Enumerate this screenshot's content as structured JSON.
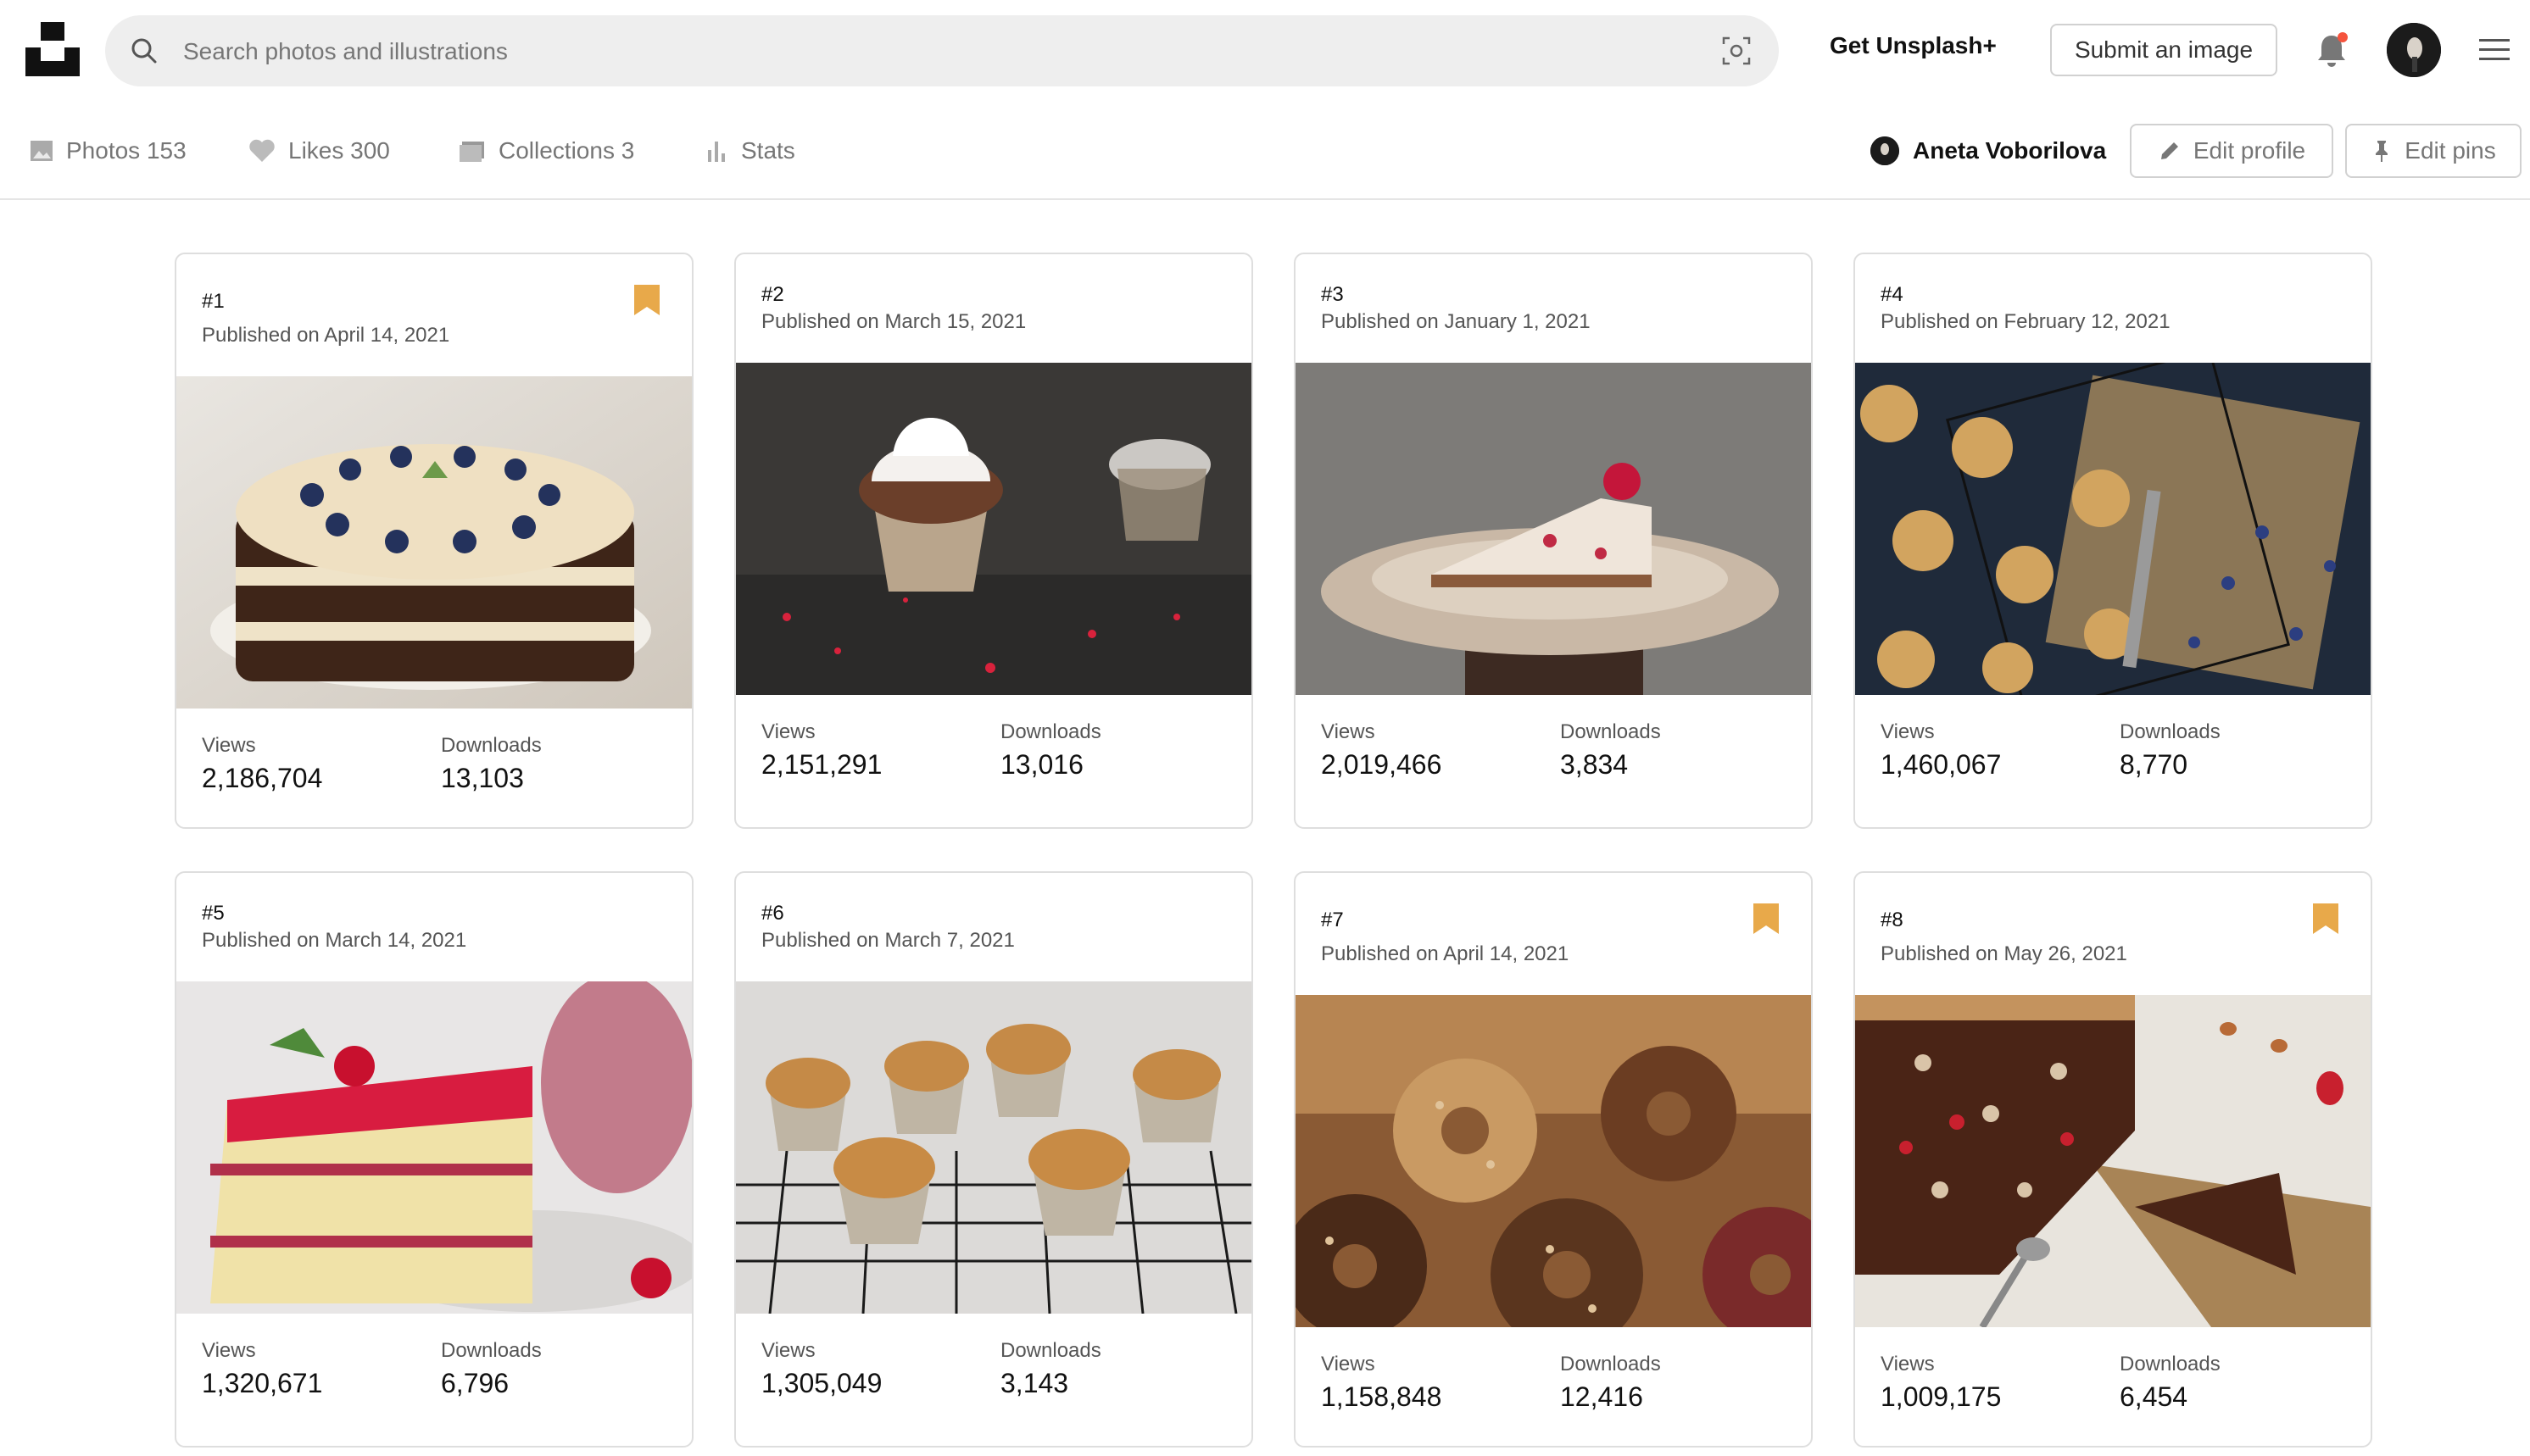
{
  "header": {
    "logo_icon": "unsplash-logo",
    "search": {
      "placeholder": "Search photos and illustrations",
      "value": ""
    },
    "get_plus_label": "Get Unsplash+",
    "submit_label": "Submit an image",
    "notification_dot_color": "#f5533d"
  },
  "tabs": [
    {
      "label": "Photos 153",
      "icon": "image-icon"
    },
    {
      "label": "Likes 300",
      "icon": "heart-icon"
    },
    {
      "label": "Collections 3",
      "icon": "collections-icon"
    },
    {
      "label": "Stats",
      "icon": "bar-chart-icon"
    }
  ],
  "profile": {
    "name": "Aneta Voborilova",
    "edit_profile_label": "Edit profile",
    "edit_pins_label": "Edit pins"
  },
  "stats_labels": {
    "views": "Views",
    "downloads": "Downloads"
  },
  "accent_color": "#e8a94a",
  "cards": [
    {
      "rank": "#1",
      "date": "Published on April 14, 2021",
      "views": "2,186,704",
      "downloads": "13,103",
      "pinned": true,
      "photo": "layered cake with blueberries"
    },
    {
      "rank": "#2",
      "date": "Published on March 15, 2021",
      "views": "2,151,291",
      "downloads": "13,016",
      "pinned": false,
      "photo": "cupcake with cream"
    },
    {
      "rank": "#3",
      "date": "Published on January 1, 2021",
      "views": "2,019,466",
      "downloads": "3,834",
      "pinned": false,
      "photo": "cheesecake slice with raspberry"
    },
    {
      "rank": "#4",
      "date": "Published on February 12, 2021",
      "views": "1,460,067",
      "downloads": "8,770",
      "pinned": false,
      "photo": "blueberry muffins on rack"
    },
    {
      "rank": "#5",
      "date": "Published on March 14, 2021",
      "views": "1,320,671",
      "downloads": "6,796",
      "pinned": false,
      "photo": "raspberry layer cake slice"
    },
    {
      "rank": "#6",
      "date": "Published on March 7, 2021",
      "views": "1,305,049",
      "downloads": "3,143",
      "pinned": false,
      "photo": "muffins on cooling rack"
    },
    {
      "rank": "#7",
      "date": "Published on April 14, 2021",
      "views": "1,158,848",
      "downloads": "12,416",
      "pinned": true,
      "photo": "glazed donuts"
    },
    {
      "rank": "#8",
      "date": "Published on May 26, 2021",
      "views": "1,009,175",
      "downloads": "6,454",
      "pinned": true,
      "photo": "chocolate tart with nuts"
    }
  ]
}
